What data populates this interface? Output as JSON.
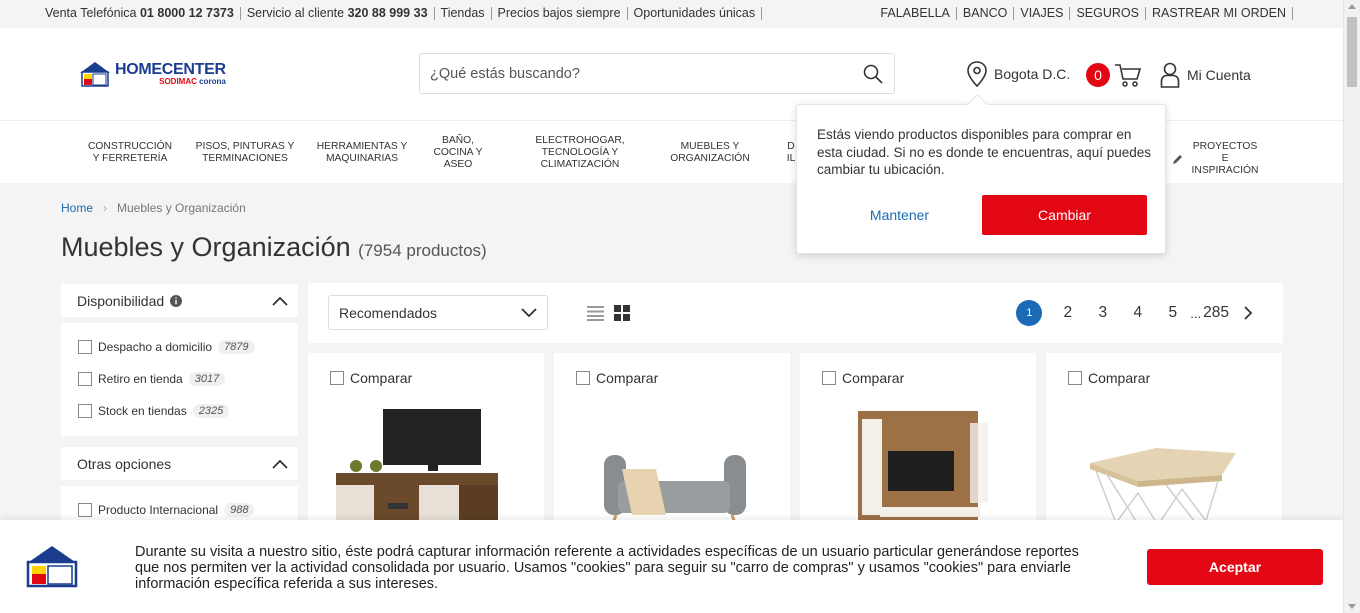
{
  "topbar": {
    "left": [
      {
        "label": "Venta Telefónica ",
        "value": "01 8000 12 7373"
      },
      {
        "label": "Servicio al cliente ",
        "value": "320 88 999 33"
      },
      {
        "label": "Tiendas",
        "value": ""
      },
      {
        "label": "Precios bajos siempre",
        "value": ""
      },
      {
        "label": "Oportunidades únicas",
        "value": ""
      }
    ],
    "right": [
      "FALABELLA",
      "BANCO",
      "VIAJES",
      "SEGUROS",
      "RASTREAR MI ORDEN"
    ]
  },
  "brand": {
    "name": "HOMECENTER",
    "sub1": "SODIMAC",
    "sub2": "corona"
  },
  "search": {
    "placeholder": "¿Qué estás buscando?"
  },
  "location": {
    "city": "Bogota D.C."
  },
  "cart": {
    "count": "0"
  },
  "account": {
    "label": "Mi Cuenta"
  },
  "nav": [
    {
      "l1": "Construcción",
      "l2": "y Ferretería",
      "l3": ""
    },
    {
      "l1": "Pisos, Pinturas y",
      "l2": "Terminaciones",
      "l3": ""
    },
    {
      "l1": "Herramientas y",
      "l2": "Maquinarias",
      "l3": ""
    },
    {
      "l1": "Baño,",
      "l2": "Cocina y",
      "l3": "Aseo"
    },
    {
      "l1": "Electrohogar,",
      "l2": "Tecnología y",
      "l3": "Climatización"
    },
    {
      "l1": "Muebles y",
      "l2": "Organización",
      "l3": ""
    },
    {
      "l1": "D",
      "l2": "IL",
      "l3": ""
    },
    {
      "l1": "Proyectos e",
      "l2": "Inspiración",
      "l3": ""
    }
  ],
  "breadcrumb": {
    "home": "Home",
    "current": "Muebles y Organización"
  },
  "page": {
    "title": "Muebles y Organización",
    "count": "(7954 productos)"
  },
  "filters": {
    "availability": {
      "title": "Disponibilidad",
      "options": [
        {
          "label": "Despacho a domicilio",
          "count": "7879"
        },
        {
          "label": "Retiro en tienda",
          "count": "3017"
        },
        {
          "label": "Stock en tiendas",
          "count": "2325"
        }
      ]
    },
    "other": {
      "title": "Otras opciones",
      "options": [
        {
          "label": "Producto Internacional",
          "count": "988"
        }
      ]
    }
  },
  "sort": {
    "selected": "Recomendados"
  },
  "pagination": {
    "pages": [
      "1",
      "2",
      "3",
      "4",
      "5"
    ],
    "ellipsis": "...",
    "last": "285"
  },
  "products": [
    {
      "compare": "Comparar"
    },
    {
      "compare": "Comparar"
    },
    {
      "compare": "Comparar"
    },
    {
      "compare": "Comparar"
    }
  ],
  "popup": {
    "message": "Estás viendo productos disponibles para comprar en esta ciudad. Si no es donde te encuentras, aquí puedes cambiar tu ubicación.",
    "keep": "Mantener",
    "change": "Cambiar"
  },
  "cookie": {
    "message": "Durante su visita a nuestro sitio, éste podrá capturar información referente a actividades específicas de un usuario particular generándose reportes que nos permiten ver la actividad consolidada por usuario. Usamos \"cookies\" para seguir su \"carro de compras\" y usamos \"cookies\" para enviarle información específica referida a sus intereses.",
    "accept": "Aceptar"
  },
  "colors": {
    "brand_red": "#e30613",
    "brand_blue": "#1a3d8f",
    "link_blue": "#1a6ab5"
  },
  "icons": [
    "search-icon",
    "location-pin-icon",
    "cart-icon",
    "user-icon",
    "info-icon",
    "chevron-up-icon",
    "chevron-down-icon",
    "list-view-icon",
    "grid-view-icon",
    "chevron-right-icon",
    "pencil-icon",
    "homecenter-house-logo"
  ]
}
